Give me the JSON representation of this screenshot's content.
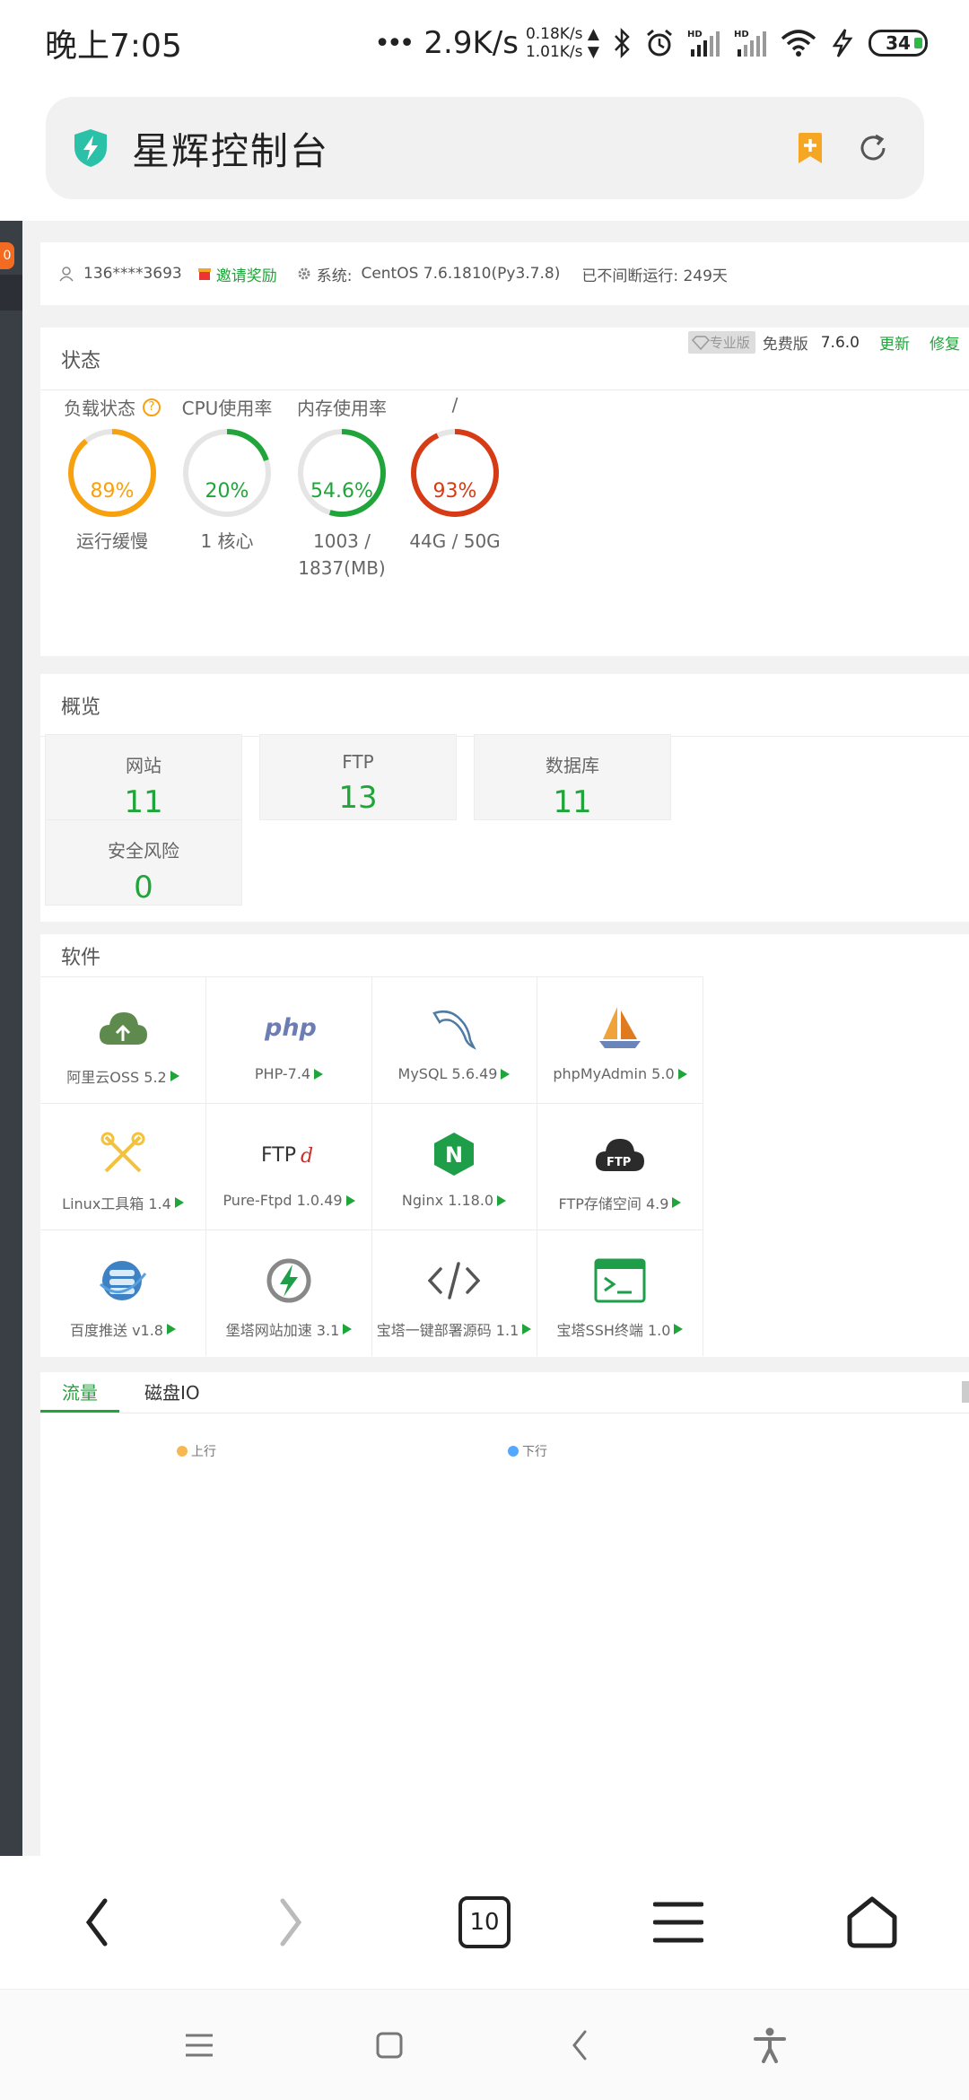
{
  "status_bar": {
    "time": "晚上7:05",
    "net_speed": "2.9K/s",
    "up_speed": "0.18K/s ▲",
    "down_speed": "1.01K/s ▼",
    "battery": "34"
  },
  "address_bar": {
    "title": "星辉控制台"
  },
  "user_row": {
    "phone": "136****3693",
    "invite": "邀请奖励",
    "system_label": "系统:",
    "system_value": "CentOS 7.6.1810(Py3.7.8)",
    "uptime": "已不间断运行: 249天"
  },
  "status": {
    "title": "状态",
    "pro_label": "专业版",
    "free_label": "免费版",
    "version": "7.6.0",
    "update": "更新",
    "repair": "修复",
    "gauges": [
      {
        "title": "负载状态",
        "value": "89%",
        "sub": "运行缓慢",
        "sub2": "",
        "percent": 89,
        "color": "#f7a10e"
      },
      {
        "title": "CPU使用率",
        "value": "20%",
        "sub": "1 核心",
        "sub2": "",
        "percent": 20,
        "color": "#20a53a"
      },
      {
        "title": "内存使用率",
        "value": "54.6%",
        "sub": "1003 /",
        "sub2": "1837(MB)",
        "percent": 54.6,
        "color": "#20a53a"
      },
      {
        "title": "/",
        "value": "93%",
        "sub": "44G / 50G",
        "sub2": "",
        "percent": 93,
        "color": "#d63b15"
      }
    ]
  },
  "overview": {
    "title": "概览",
    "items": [
      {
        "label": "网站",
        "value": "11"
      },
      {
        "label": "FTP",
        "value": "13"
      },
      {
        "label": "数据库",
        "value": "11"
      },
      {
        "label": "安全风险",
        "value": "0"
      }
    ]
  },
  "software": {
    "title": "软件",
    "items": [
      {
        "name": "阿里云OSS 5.2",
        "icon": "cloud-upload-icon"
      },
      {
        "name": "PHP-7.4",
        "icon": "php-icon"
      },
      {
        "name": "MySQL 5.6.49",
        "icon": "mysql-dolphin-icon"
      },
      {
        "name": "phpMyAdmin 5.0",
        "icon": "phpmyadmin-sailboat-icon"
      },
      {
        "name": "Linux工具箱 1.4",
        "icon": "tools-icon"
      },
      {
        "name": "Pure-Ftpd 1.0.49",
        "icon": "ftpd-icon"
      },
      {
        "name": "Nginx 1.18.0",
        "icon": "nginx-icon"
      },
      {
        "name": "FTP存储空间 4.9",
        "icon": "ftp-cloud-icon"
      },
      {
        "name": "百度推送 v1.8",
        "icon": "database-globe-icon"
      },
      {
        "name": "堡塔网站加速 3.1",
        "icon": "lightning-icon"
      },
      {
        "name": "宝塔一键部署源码 1.1",
        "icon": "code-icon"
      },
      {
        "name": "宝塔SSH终端 1.0",
        "icon": "terminal-icon"
      }
    ],
    "ftpd_text": "FTPd",
    "php_text": "php",
    "ftp_text": "FTP",
    "nginx_text": "N"
  },
  "traffic": {
    "tabs": [
      "流量",
      "磁盘IO"
    ],
    "up": "上行",
    "down": "下行",
    "up_color": "#f7b851",
    "down_color": "#52a9ff"
  },
  "browser_bar": {
    "tab_count": "10"
  },
  "colors": {
    "accent": "#20a53a",
    "sidebar": "#3a3f45"
  }
}
